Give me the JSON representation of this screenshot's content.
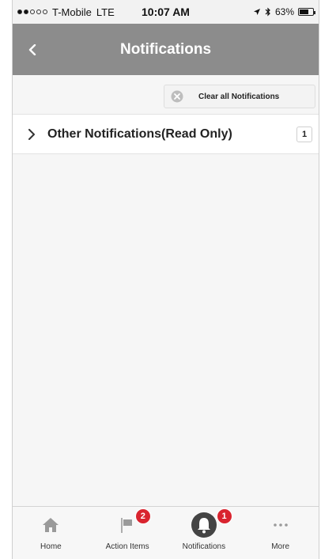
{
  "status_bar": {
    "carrier": "T-Mobile",
    "network": "LTE",
    "time": "10:07 AM",
    "battery_percent": "63%",
    "signal_bars_filled": 2,
    "signal_bars_total": 5
  },
  "header": {
    "title": "Notifications",
    "back_icon": "chevron-left-icon"
  },
  "toolbar": {
    "clear_all_label": "Clear all Notifications",
    "clear_icon": "close-circle-icon"
  },
  "notification_groups": [
    {
      "label": "Other Notifications(Read Only)",
      "count": "1",
      "icon": "chevron-right-icon"
    }
  ],
  "tab_bar": {
    "tabs": [
      {
        "label": "Home",
        "icon": "home-icon",
        "badge": ""
      },
      {
        "label": "Action Items",
        "icon": "flag-icon",
        "badge": "2"
      },
      {
        "label": "Notifications",
        "icon": "bell-icon",
        "badge": "1",
        "active": true
      },
      {
        "label": "More",
        "icon": "more-icon",
        "badge": ""
      }
    ]
  },
  "colors": {
    "header_bg": "#8c8c8c",
    "badge_red": "#d9242f",
    "active_icon": "#444444",
    "inactive_icon": "#9a9a9a"
  }
}
